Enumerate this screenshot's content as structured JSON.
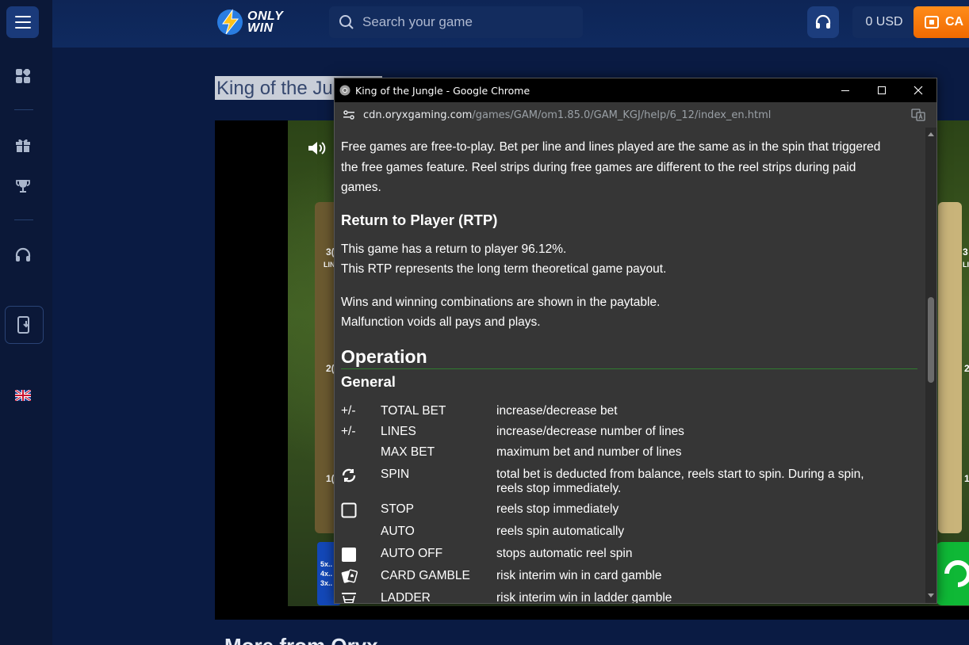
{
  "site": {
    "logo_line1": "ONLY",
    "logo_line2": "WIN",
    "search_placeholder": "Search your game",
    "balance": "0 USD",
    "cashier_label": "CA"
  },
  "game": {
    "title": "King of the Jungle",
    "left_nums": [
      "3(",
      "LIN",
      "2(",
      "1("
    ],
    "right_nums": [
      "3",
      "LI",
      "2",
      "1"
    ],
    "multipliers": [
      "5x..",
      "4x..",
      "3x.."
    ],
    "footer_heading": "More from Oryx"
  },
  "popup": {
    "window_title": "King of the Jungle - Google Chrome",
    "url_host": "cdn.oryxgaming.com",
    "url_path": "/games/GAM/om1.85.0/GAM_KGJ/help/6_12/index_en.html",
    "free_games_text": "Free games are free-to-play. Bet per line and lines played are the same as in the spin that triggered the free games feature. Reel strips during free games are different to the reel strips during paid games.",
    "rtp_heading": "Return to Player (RTP)",
    "rtp_line1": "This game has a return to player 96.12%.",
    "rtp_line2": "This RTP represents the long term theoretical game payout.",
    "wins_line1": "Wins and winning combinations are shown in the paytable.",
    "wins_line2": "Malfunction voids all pays and plays.",
    "operation_heading": "Operation",
    "general_heading": "General",
    "controls": [
      {
        "symbol": "+/-",
        "icon": "",
        "key": "TOTAL BET",
        "desc": "increase/decrease bet"
      },
      {
        "symbol": "+/-",
        "icon": "",
        "key": "LINES",
        "desc": "increase/decrease number of lines"
      },
      {
        "symbol": "",
        "icon": "",
        "key": "MAX BET",
        "desc": "maximum bet and number of lines"
      },
      {
        "symbol": "",
        "icon": "spin-icon",
        "key": "SPIN",
        "desc": "total bet is deducted from balance, reels start to spin. During a spin, reels stop immediately."
      },
      {
        "symbol": "",
        "icon": "stop-icon",
        "key": "STOP",
        "desc": "reels stop immediately"
      },
      {
        "symbol": "",
        "icon": "",
        "key": "AUTO",
        "desc": "reels spin automatically"
      },
      {
        "symbol": "",
        "icon": "auto-off-icon",
        "key": "AUTO OFF",
        "desc": "stops automatic reel spin"
      },
      {
        "symbol": "",
        "icon": "cards-icon",
        "key": "CARD GAMBLE",
        "desc": "risk interim win in card gamble"
      },
      {
        "symbol": "",
        "icon": "ladder-icon",
        "key": "LADDER",
        "desc": "risk interim win in ladder gamble"
      }
    ]
  },
  "colors": {
    "page_bg": "#0a1b43",
    "cashier_orange": "#f57c00",
    "popup_bg": "#363636",
    "rule_green": "#2f7d2f"
  }
}
